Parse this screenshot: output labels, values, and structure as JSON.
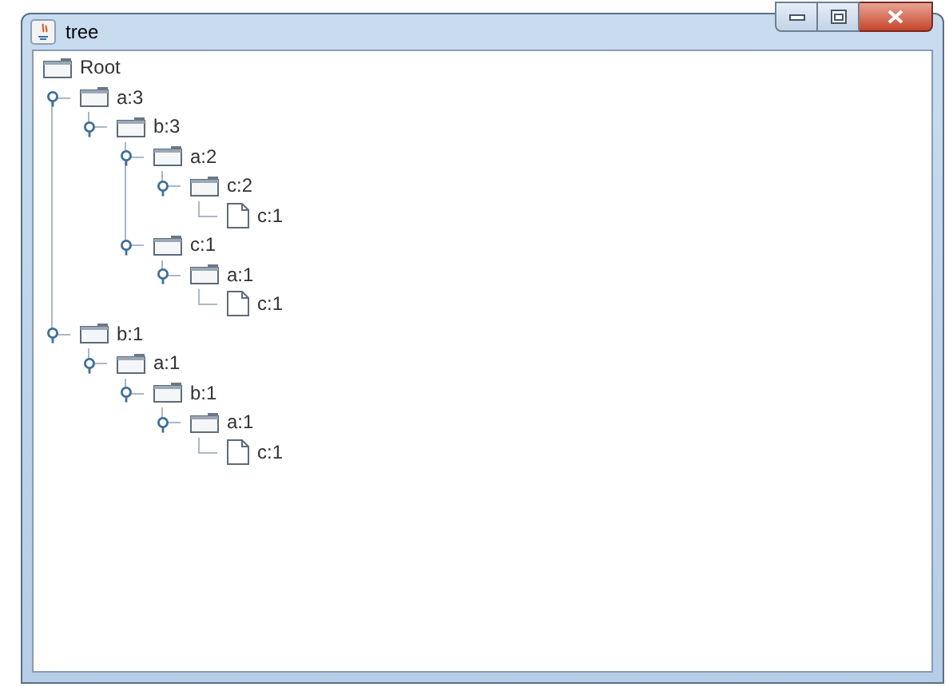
{
  "window": {
    "title": "tree"
  },
  "tree": {
    "label": "Root",
    "kind": "folder",
    "children": [
      {
        "label": "a:3",
        "kind": "folder",
        "expanded": true,
        "children": [
          {
            "label": "b:3",
            "kind": "folder",
            "expanded": true,
            "children": [
              {
                "label": "a:2",
                "kind": "folder",
                "expanded": true,
                "children": [
                  {
                    "label": "c:2",
                    "kind": "folder",
                    "expanded": true,
                    "children": [
                      {
                        "label": "c:1",
                        "kind": "file"
                      }
                    ]
                  }
                ]
              },
              {
                "label": "c:1",
                "kind": "folder",
                "expanded": true,
                "children": [
                  {
                    "label": "a:1",
                    "kind": "folder",
                    "expanded": true,
                    "children": [
                      {
                        "label": "c:1",
                        "kind": "file"
                      }
                    ]
                  }
                ]
              }
            ]
          }
        ]
      },
      {
        "label": "b:1",
        "kind": "folder",
        "expanded": true,
        "children": [
          {
            "label": "a:1",
            "kind": "folder",
            "expanded": true,
            "children": [
              {
                "label": "b:1",
                "kind": "folder",
                "expanded": true,
                "children": [
                  {
                    "label": "a:1",
                    "kind": "folder",
                    "expanded": true,
                    "children": [
                      {
                        "label": "c:1",
                        "kind": "file"
                      }
                    ]
                  }
                ]
              }
            ]
          }
        ]
      }
    ]
  }
}
